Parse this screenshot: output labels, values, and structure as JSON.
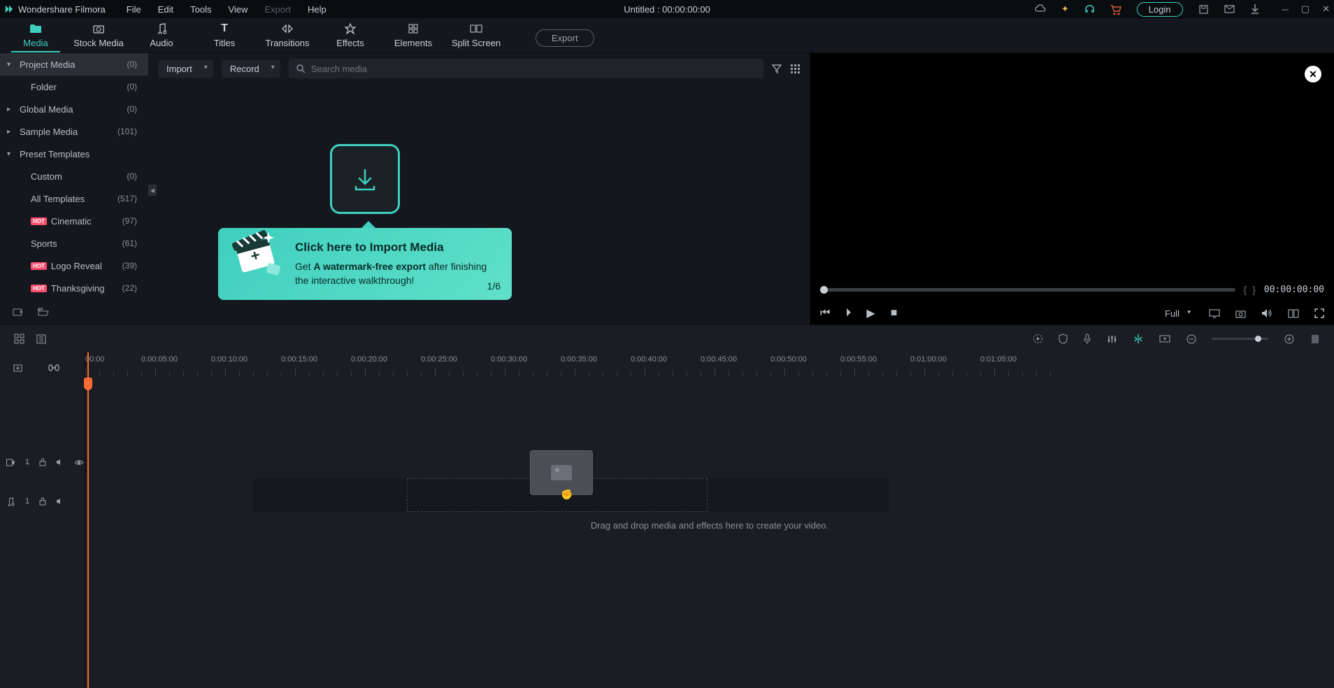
{
  "titlebar": {
    "app_name": "Wondershare Filmora",
    "menus": [
      "File",
      "Edit",
      "Tools",
      "View",
      "Export",
      "Help"
    ],
    "center": "Untitled : 00:00:00:00",
    "login": "Login"
  },
  "tabs": [
    {
      "label": "Media",
      "active": true
    },
    {
      "label": "Stock Media",
      "active": false
    },
    {
      "label": "Audio",
      "active": false
    },
    {
      "label": "Titles",
      "active": false
    },
    {
      "label": "Transitions",
      "active": false
    },
    {
      "label": "Effects",
      "active": false
    },
    {
      "label": "Elements",
      "active": false
    },
    {
      "label": "Split Screen",
      "active": false
    }
  ],
  "export_btn": "Export",
  "toolbar": {
    "import": "Import",
    "record": "Record",
    "search_placeholder": "Search media"
  },
  "sidebar": [
    {
      "label": "Project Media",
      "count": "(0)",
      "chev": "▾",
      "selected": true,
      "indent": false
    },
    {
      "label": "Folder",
      "count": "(0)",
      "indent": true
    },
    {
      "label": "Global Media",
      "count": "(0)",
      "chev": "▸",
      "indent": false
    },
    {
      "label": "Sample Media",
      "count": "(101)",
      "chev": "▸",
      "indent": false
    },
    {
      "label": "Preset Templates",
      "count": "",
      "chev": "▾",
      "indent": false
    },
    {
      "label": "Custom",
      "count": "(0)",
      "indent": true
    },
    {
      "label": "All Templates",
      "count": "(517)",
      "indent": true
    },
    {
      "label": "Cinematic",
      "count": "(97)",
      "indent": true,
      "hot": true
    },
    {
      "label": "Sports",
      "count": "(61)",
      "indent": true
    },
    {
      "label": "Logo Reveal",
      "count": "(39)",
      "indent": true,
      "hot": true
    },
    {
      "label": "Thanksgiving",
      "count": "(22)",
      "indent": true,
      "hot": true
    }
  ],
  "hot_badge": "HOT",
  "onboard": {
    "title": "Click here to Import Media",
    "body_pre": "Get ",
    "body_bold": "A watermark-free export",
    "body_post": " after finishing the interactive walkthrough!",
    "step": "1/6"
  },
  "preview": {
    "time": "00:00:00:00",
    "quality": "Full"
  },
  "ruler_marks": [
    "00:00",
    "0:00:05:00",
    "0:00:10:00",
    "0:00:15:00",
    "0:00:20:00",
    "0:00:25:00",
    "0:00:30:00",
    "0:00:35:00",
    "0:00:40:00",
    "0:00:45:00",
    "0:00:50:00",
    "0:00:55:00",
    "0:01:00:00",
    "0:01:05:00"
  ],
  "track_video": "1",
  "track_audio": "1",
  "drop_hint": "Drag and drop media and effects here to create your video."
}
